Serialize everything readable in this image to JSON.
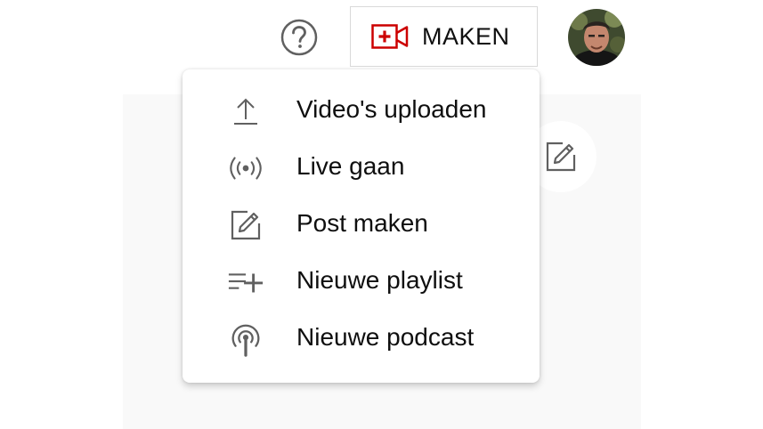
{
  "header": {
    "help_icon": "question-circle-icon",
    "create_button": {
      "label": "MAKEN",
      "icon": "video-camera-plus-icon",
      "icon_color": "#cc0000"
    },
    "avatar_icon": "user-avatar"
  },
  "menu": {
    "items": [
      {
        "label": "Video's uploaden",
        "icon": "upload-icon"
      },
      {
        "label": "Live gaan",
        "icon": "live-broadcast-icon"
      },
      {
        "label": "Post maken",
        "icon": "edit-post-icon"
      },
      {
        "label": "Nieuwe playlist",
        "icon": "playlist-add-icon"
      },
      {
        "label": "Nieuwe podcast",
        "icon": "podcast-icon"
      }
    ]
  },
  "background": {
    "edit_icon": "edit-pencil-icon"
  },
  "colors": {
    "accent_red": "#cc0000",
    "icon_gray": "#606060",
    "text": "#0f0f0f",
    "panel_bg": "#f9f9f9"
  }
}
